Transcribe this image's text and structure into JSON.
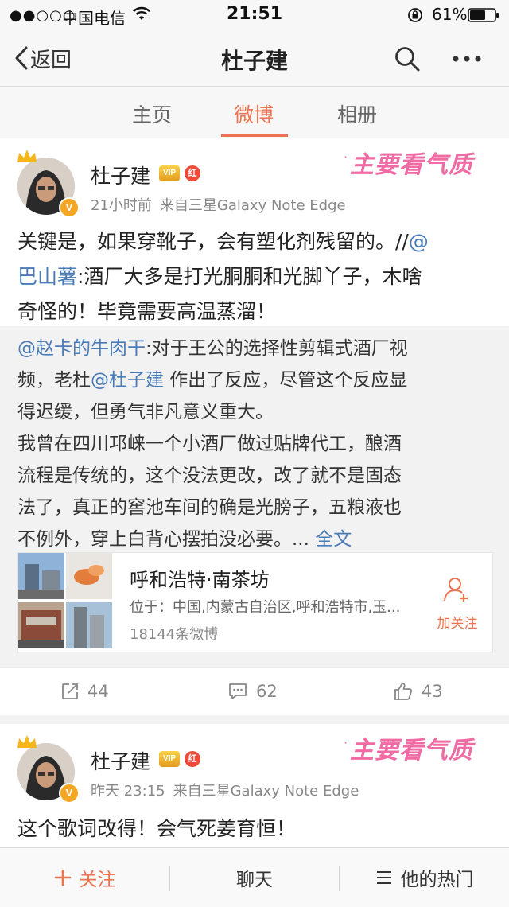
{
  "status_bar": {
    "signal": "●●○○○",
    "carrier": "中国电信",
    "time": "21:51",
    "battery": "61%"
  },
  "nav": {
    "back_label": "返回",
    "title": "杜子建"
  },
  "tabs": [
    {
      "label": "主页",
      "active": false
    },
    {
      "label": "微博",
      "active": true
    },
    {
      "label": "相册",
      "active": false
    }
  ],
  "watermark": "主要看气质",
  "posts": [
    {
      "author": "杜子建",
      "vip_badge": "VIP",
      "red_badge": "红",
      "time": "21小时前",
      "source": "来自三星Galaxy Note Edge",
      "text_lines": [
        {
          "pre": "关键是，如果穿靴子，会有塑化剂残留的。//",
          "link": "@"
        },
        {
          "link": "巴山薯",
          "post": ":酒厂大多是打光胴胴和光脚丫子，木啥"
        },
        {
          "pre": "奇怪的！毕竟需要高温蒸溜！"
        }
      ],
      "repost": {
        "mention": "@赵卡的牛肉干",
        "line1": ":对于王公的选择性剪辑式酒厂视",
        "line2_pre": "频，老杜",
        "line2_mention": "@杜子建",
        "line2_post": " 作出了反应，尽管这个反应显",
        "line3": "得迟缓，但勇气非凡意义重大。",
        "line4": "我曾在四川邛崃一个小酒厂做过贴牌代工，酿酒",
        "line5": "流程是传统的，这个没法更改，改了就不是固态",
        "line6": "法了，真正的窖池车间的确是光膀子，五粮液也",
        "line7_pre": "不例外，穿上白背心摆拍没必要。... ",
        "full_text": "全文"
      },
      "location": {
        "name": "呼和浩特·南茶坊",
        "address": "位于：中国,内蒙古自治区,呼和浩特市,玉...",
        "count": "18144条微博",
        "follow_label": "加关注"
      },
      "actions": {
        "repost_count": "44",
        "comment_count": "62",
        "like_count": "43"
      }
    },
    {
      "author": "杜子建",
      "vip_badge": "VIP",
      "red_badge": "红",
      "time": "昨天 23:15",
      "source": "来自三星Galaxy Note Edge",
      "text": "这个歌词改得！会气死姜育恒！"
    }
  ],
  "bottom_bar": {
    "follow": "关注",
    "chat": "聊天",
    "hot": "他的热门"
  },
  "colors": {
    "accent": "#eb7350",
    "link": "#4a7bb7",
    "watermark": "#f06aa3"
  }
}
